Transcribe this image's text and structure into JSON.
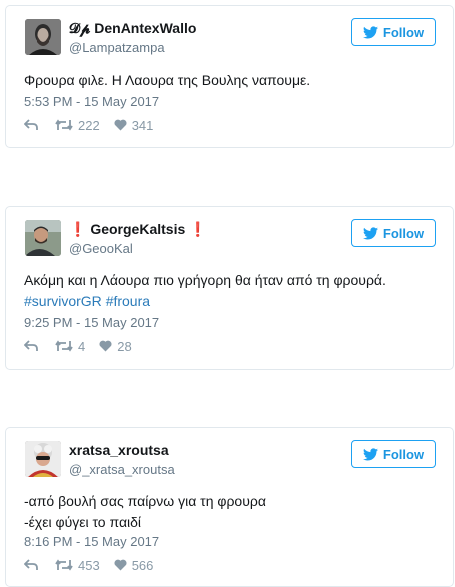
{
  "colors": {
    "twitter_blue": "#1da1f2",
    "link": "#2b7bb9",
    "muted": "#657786",
    "action": "#8899a6"
  },
  "follow_label": "Follow",
  "tweets": [
    {
      "name": "𝓓𝓹 DenAntexWallo",
      "handle": "@Lampatzampa",
      "lines": [
        "Φρουρα φιλε. Η Λαουρα της Βουλης ναπουμε."
      ],
      "timestamp": "5:53 PM - 15 May 2017",
      "retweets": "222",
      "likes": "341"
    },
    {
      "name": "❗ GeorgeKaltsis ❗",
      "handle": "@GeooKal",
      "lines": [
        "Ακόμη και η Λάουρα πιο γρήγορη θα ήταν από τη φρουρά."
      ],
      "hashtags": [
        "#survivorGR",
        "#froura"
      ],
      "timestamp": "9:25 PM - 15 May 2017",
      "retweets": "4",
      "likes": "28"
    },
    {
      "name": "xratsa_xroutsa",
      "handle": "@_xratsa_xroutsa",
      "lines": [
        "-από βουλή σας παίρνω για τη φρουρα",
        "-έχει φύγει το παιδί"
      ],
      "timestamp": "8:16 PM - 15 May 2017",
      "retweets": "453",
      "likes": "566"
    }
  ]
}
